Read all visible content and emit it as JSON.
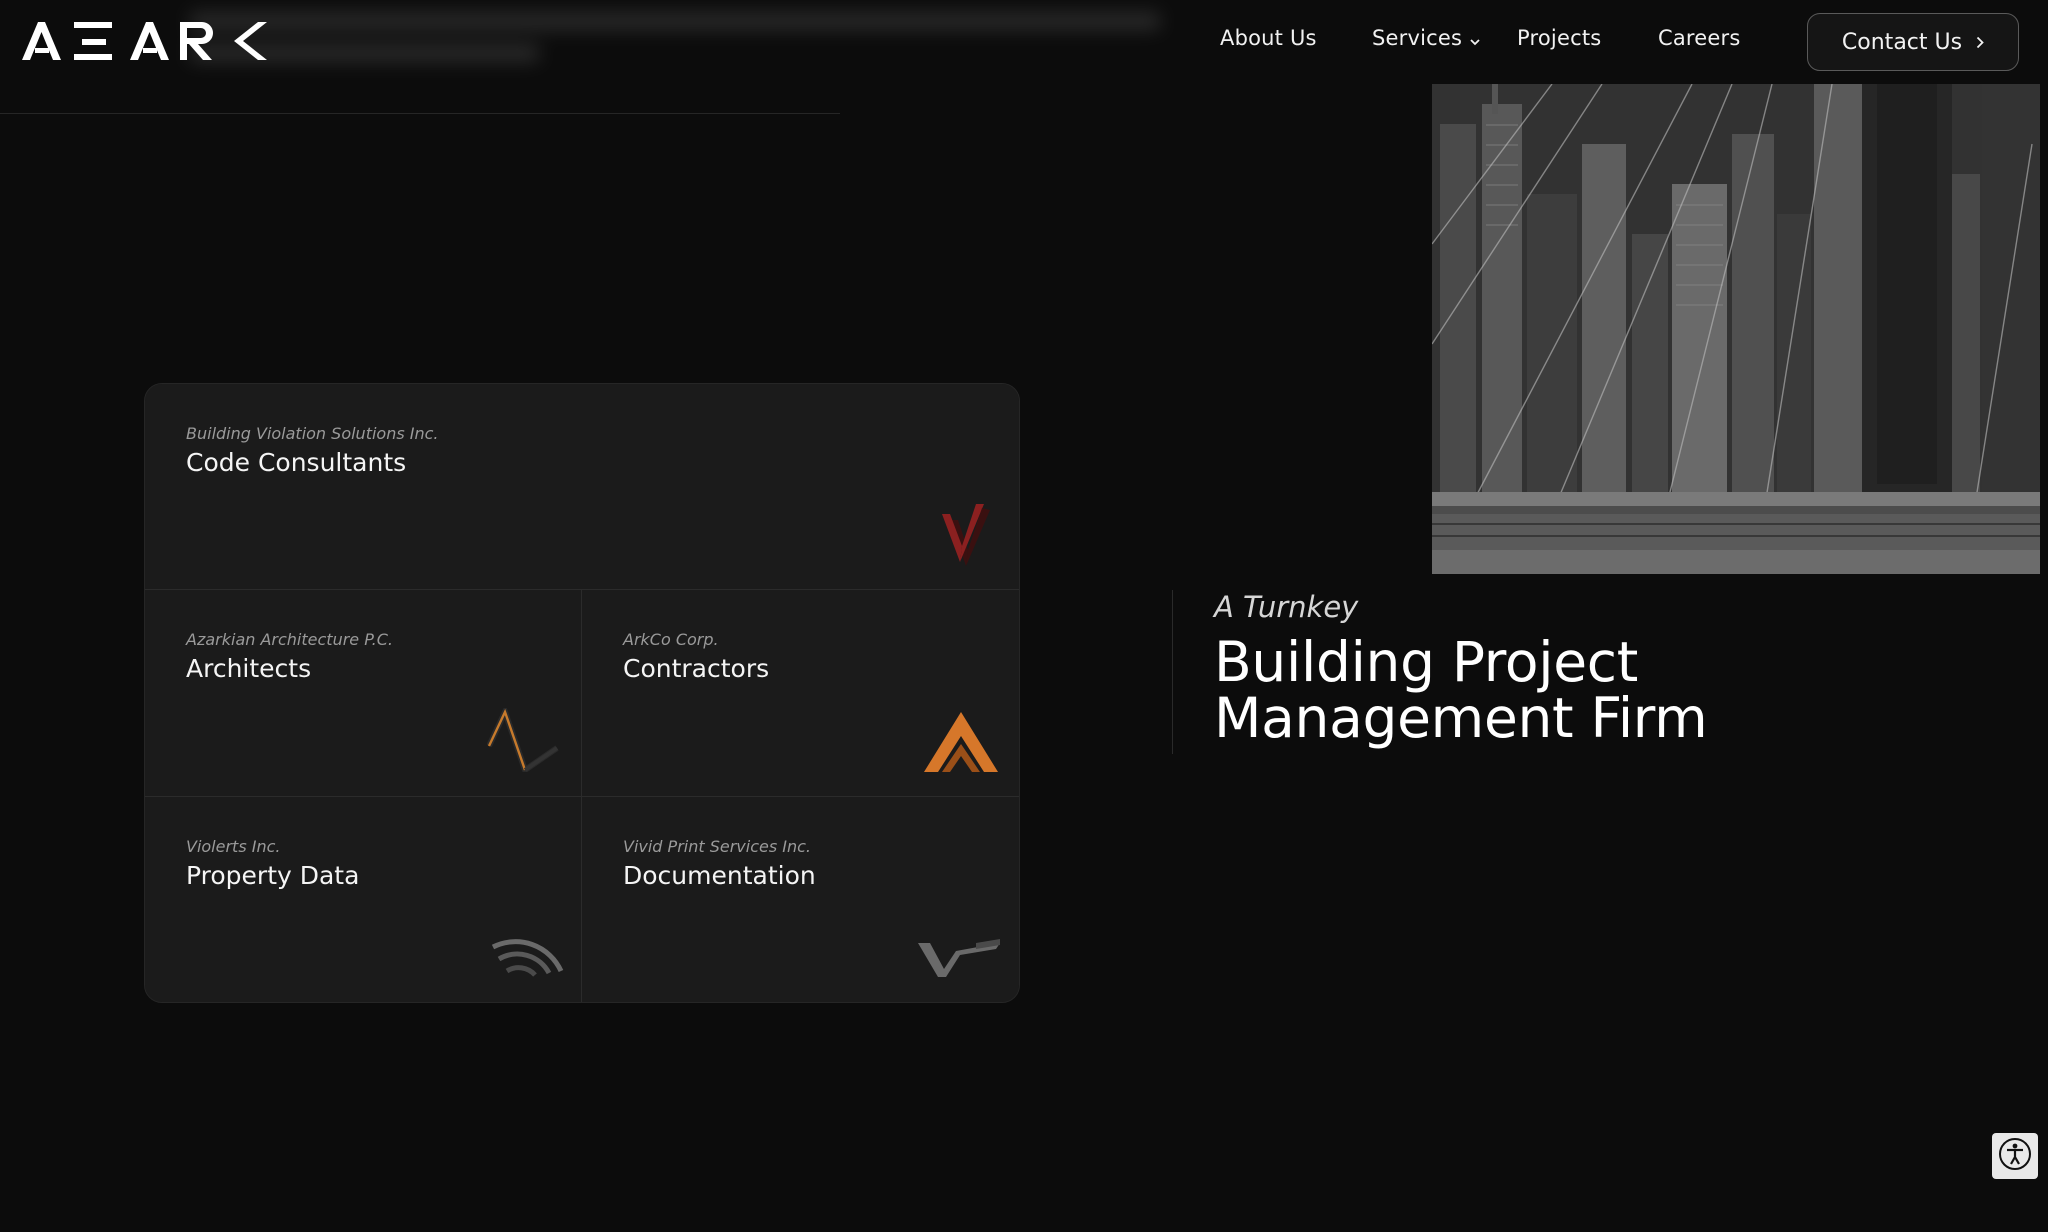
{
  "brand": {
    "logo_text": "AZARK"
  },
  "nav": {
    "about": "About Us",
    "services": "Services",
    "projects": "Projects",
    "careers": "Careers",
    "contact": "Contact Us"
  },
  "hero": {
    "subtitle": "A Turnkey",
    "title_line1": "Building Project",
    "title_line2": "Management Firm"
  },
  "services": [
    {
      "company": "Building Violation Solutions Inc.",
      "label": "Code Consultants",
      "icon": "checkmark-icon",
      "color": "#8b2020"
    },
    {
      "company": "Azarkian Architecture P.C.",
      "label": "Architects",
      "icon": "architecture-arch-icon",
      "color": "#c67a2c"
    },
    {
      "company": "ArkCo Corp.",
      "label": "Contractors",
      "icon": "contractor-triangle-icon",
      "color": "#d6772a"
    },
    {
      "company": "Violerts Inc.",
      "label": "Property Data",
      "icon": "signal-waves-icon",
      "color": "#6a6a6a"
    },
    {
      "company": "Vivid Print Services Inc.",
      "label": "Documentation",
      "icon": "print-check-icon",
      "color": "#6a6a6a"
    }
  ],
  "colors": {
    "background": "#0c0c0c",
    "card": "#1b1b1b",
    "text": "#ffffff"
  }
}
